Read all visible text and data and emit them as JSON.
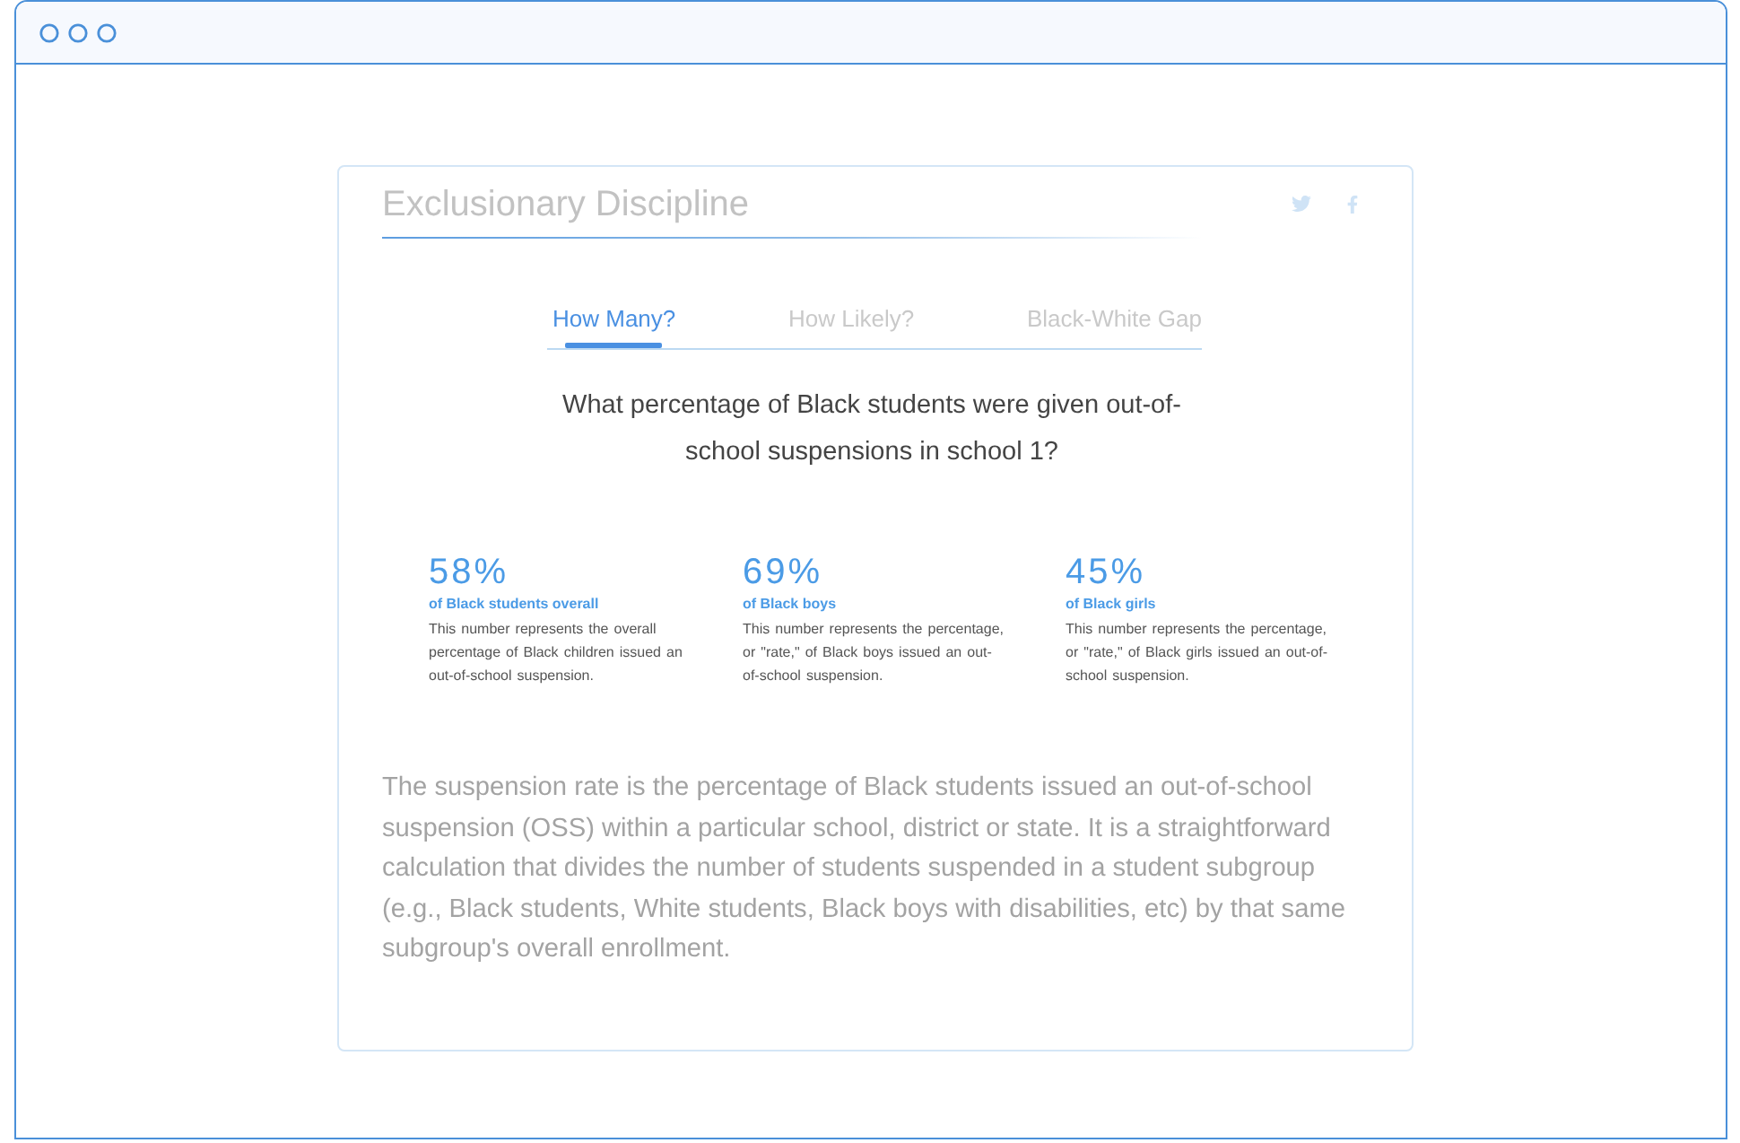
{
  "card": {
    "title": "Exclusionary Discipline"
  },
  "tabs": [
    {
      "label": "How Many?",
      "selected": true
    },
    {
      "label": "How Likely?",
      "selected": false
    },
    {
      "label": "Black-White Gap",
      "selected": false
    }
  ],
  "question": "What percentage of Black students were given out-of-school suspensions in school 1?",
  "stats": [
    {
      "value": "58%",
      "label": "of Black students overall",
      "description": "This number represents the overall percentage of Black children issued an out-of-school suspension."
    },
    {
      "value": "69%",
      "label": "of Black boys",
      "description": "This number represents the percentage, or \"rate,\" of Black boys issued an out-of-school suspension."
    },
    {
      "value": "45%",
      "label": "of Black girls",
      "description": "This number represents the percentage, or \"rate,\" of Black girls issued an out-of-school suspension."
    }
  ],
  "explanation": "The suspension rate is the percentage of Black students issued an out-of-school suspension (OSS) within a particular school, district or state. It is a straightforward calculation that divides the number of students suspended in a student subgroup (e.g., Black students, White students, Black boys with disabilities, etc) by that same subgroup's overall enrollment."
}
